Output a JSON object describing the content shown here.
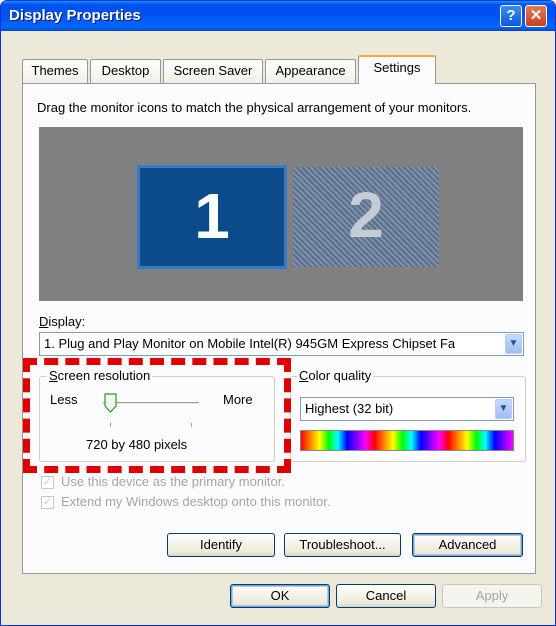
{
  "window": {
    "title": "Display Properties",
    "help_glyph": "?",
    "close_glyph": "✕"
  },
  "tabs": [
    "Themes",
    "Desktop",
    "Screen Saver",
    "Appearance",
    "Settings"
  ],
  "settings": {
    "instruction": "Drag the monitor icons to match the physical arrangement of your monitors.",
    "monitor1_label": "1",
    "monitor2_label": "2",
    "display_label": "Display:",
    "display_value": "1. Plug and Play Monitor on Mobile Intel(R) 945GM Express Chipset Fa",
    "resolution": {
      "group_label": "Screen resolution",
      "less_label": "Less",
      "more_label": "More",
      "value_text": "720 by 480 pixels",
      "slider_level": 0
    },
    "color_quality": {
      "group_label": "Color quality",
      "value": "Highest (32 bit)",
      "spectrum_colors": [
        "#ff0000",
        "#ff8000",
        "#ffff00",
        "#00ff00",
        "#00ffff",
        "#0000ff",
        "#8000ff",
        "#ff00ff"
      ]
    },
    "checkbox_primary": "Use this device as the primary monitor.",
    "checkbox_extend": "Extend my Windows desktop onto this monitor.",
    "identify_button": "Identify",
    "troubleshoot_button": "Troubleshoot...",
    "advanced_button": "Advanced"
  },
  "footer": {
    "ok_button": "OK",
    "cancel_button": "Cancel",
    "apply_button": "Apply"
  },
  "highlight_color": "#e00000"
}
